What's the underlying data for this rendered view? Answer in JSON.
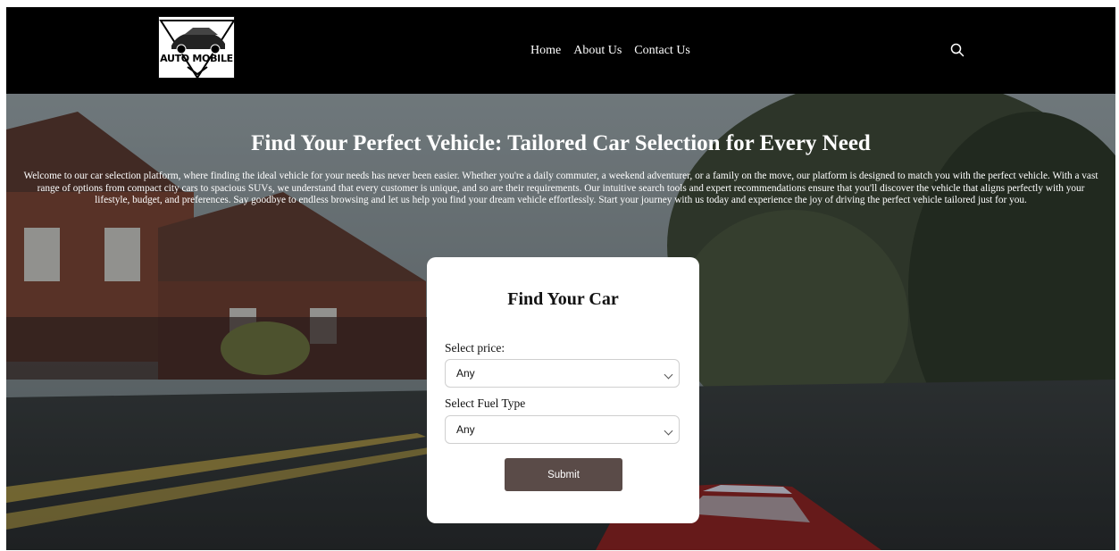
{
  "brand": {
    "logo_text": "AUTO MOBILE"
  },
  "nav": {
    "items": [
      "Home",
      "About Us",
      "Contact Us"
    ]
  },
  "hero": {
    "title": "Find Your Perfect Vehicle: Tailored Car Selection for Every Need",
    "description": "Welcome to our car selection platform, where finding the ideal vehicle for your needs has never been easier. Whether you're a daily commuter, a weekend adventurer, or a family on the move, our platform is designed to match you with the perfect vehicle. With a vast range of options from compact city cars to spacious SUVs, we understand that every customer is unique, and so are their requirements. Our intuitive search tools and expert recommendations ensure that you'll discover the vehicle that aligns perfectly with your lifestyle, budget, and preferences. Say goodbye to endless browsing and let us help you find your dream vehicle effortlessly. Start your journey with us today and experience the joy of driving the perfect vehicle tailored just for you."
  },
  "form": {
    "title": "Find Your Car",
    "price_label": "Select price:",
    "price_value": "Any",
    "fuel_label": "Select Fuel Type",
    "fuel_value": "Any",
    "submit_label": "Submit"
  },
  "colors": {
    "header_bg": "#000000",
    "submit_bg": "#5a4b48",
    "card_bg": "#ffffff"
  },
  "icons": {
    "search": "search-icon",
    "select_chevron": "chevron-down-icon"
  }
}
